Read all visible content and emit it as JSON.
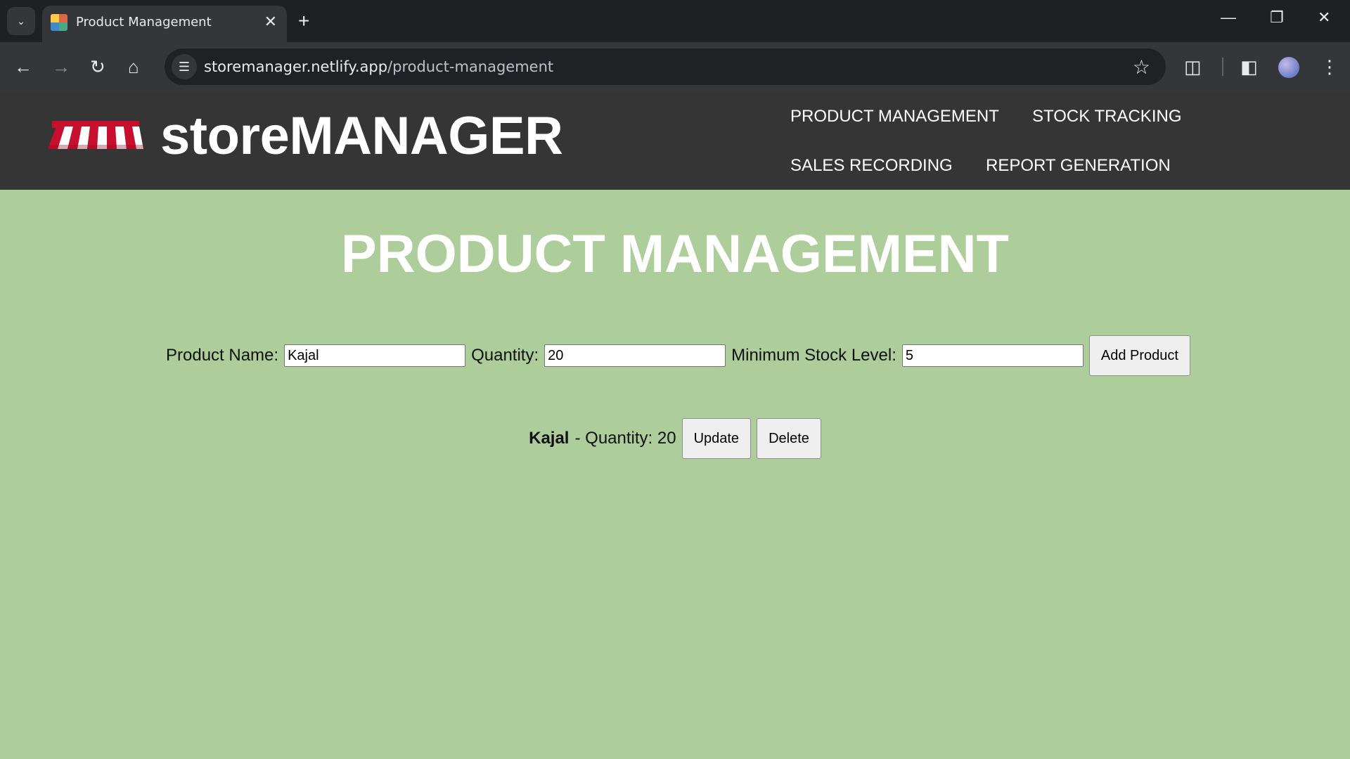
{
  "browser": {
    "tab_title": "Product Management",
    "url_domain": "storemanager.netlify.app",
    "url_path": "/product-management",
    "icons": [
      "tab-list-icon",
      "close-icon",
      "plus-icon",
      "minimize-icon",
      "restore-icon",
      "close-window-icon",
      "back-icon",
      "forward-icon",
      "reload-icon",
      "home-icon",
      "site-info-icon",
      "star-icon",
      "extensions-icon",
      "side-panel-icon",
      "profile-avatar",
      "menu-icon"
    ]
  },
  "header": {
    "brand": "storeMANAGER",
    "nav": [
      {
        "label": "PRODUCT MANAGEMENT"
      },
      {
        "label": "STOCK TRACKING"
      },
      {
        "label": "SALES RECORDING"
      },
      {
        "label": "REPORT GENERATION"
      }
    ]
  },
  "main": {
    "title": "PRODUCT MANAGEMENT",
    "form": {
      "product_name_label": "Product Name:",
      "product_name_value": "Kajal",
      "quantity_label": "Quantity:",
      "quantity_value": "20",
      "min_stock_label": "Minimum Stock Level:",
      "min_stock_value": "5",
      "add_button": "Add Product"
    },
    "products": [
      {
        "name": "Kajal",
        "quantity_text": "- Quantity: 20",
        "update_label": "Update",
        "delete_label": "Delete"
      }
    ]
  },
  "colors": {
    "page_background": "#adcd9a",
    "header_background": "#353535"
  }
}
